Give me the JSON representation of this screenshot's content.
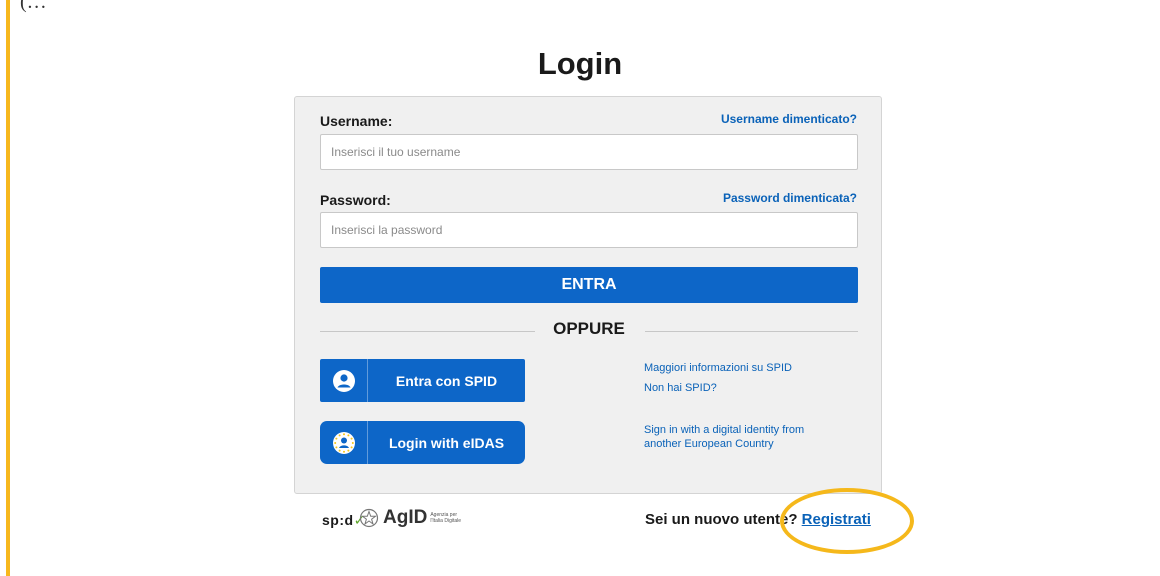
{
  "header": {
    "top_fragment": "(…",
    "page_title": "Login"
  },
  "login_form": {
    "username_label": "Username:",
    "username_forgot": "Username dimenticato?",
    "username_placeholder": "Inserisci il tuo username",
    "username_value": "",
    "password_label": "Password:",
    "password_forgot": "Password dimenticata?",
    "password_placeholder": "Inserisci la password",
    "password_value": "",
    "enter_label": "ENTRA",
    "divider_label": "OPPURE"
  },
  "spid": {
    "button_label": "Entra con SPID",
    "more_info_link": "Maggiori informazioni su SPID",
    "no_spid_link": "Non hai SPID?"
  },
  "eidas": {
    "button_label": "Login with eIDAS",
    "info_link_line1": "Sign in with a digital identity from",
    "info_link_line2": "another European Country"
  },
  "footer": {
    "spid_logo": "sp:d",
    "agid_logo": "AgID",
    "agid_sub_line1": "Agenzia per",
    "agid_sub_line2": "l'Italia Digitale",
    "signup_prompt": "Sei un nuovo utente?",
    "signup_link": "Registrati"
  },
  "colors": {
    "accent": "#0d66c8",
    "link": "#0a62b8",
    "highlight": "#f5b81b",
    "card_bg": "#f0f0f0"
  },
  "icons": {
    "spid": "person-circle-icon",
    "eidas": "eu-person-icon",
    "check": "check-icon",
    "emblem": "agid-emblem-icon"
  }
}
